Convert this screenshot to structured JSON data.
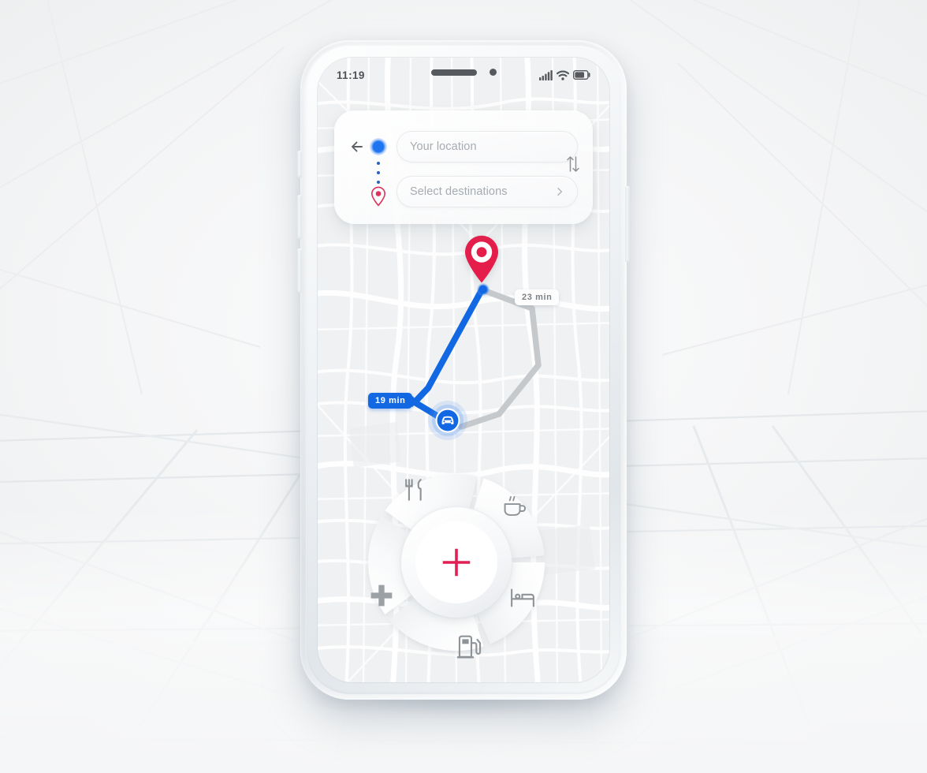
{
  "status_bar": {
    "time": "11:19",
    "signal_icon": "cellular-signal-icon",
    "wifi_icon": "wifi-icon",
    "battery_icon": "battery-icon"
  },
  "search_panel": {
    "back_icon": "back-arrow-icon",
    "origin_icon": "origin-dot-icon",
    "destination_icon": "destination-pin-icon",
    "swap_icon": "swap-vertical-icon",
    "origin_placeholder": "Your location",
    "origin_value": "",
    "destination_placeholder": "Select destinations",
    "destination_value": "",
    "destination_chevron_icon": "chevron-right-icon"
  },
  "map": {
    "destination_pin_icon": "map-pin-icon",
    "vehicle_marker_icon": "car-icon",
    "routes": [
      {
        "id": "primary",
        "label": "19 min",
        "color": "#1268e3",
        "selected": true
      },
      {
        "id": "alternate",
        "label": "23 min",
        "color": "#c6c9cc",
        "selected": false
      }
    ]
  },
  "radial_menu": {
    "center_label": "+",
    "center_icon": "plus-icon",
    "center_color": "#e01f52",
    "segments": [
      {
        "id": "restaurants",
        "icon": "fork-knife-icon",
        "label": "Restaurants"
      },
      {
        "id": "cafes",
        "icon": "coffee-cup-icon",
        "label": "Cafes"
      },
      {
        "id": "hotels",
        "icon": "bed-icon",
        "label": "Hotels"
      },
      {
        "id": "gas",
        "icon": "fuel-pump-icon",
        "label": "Gas stations"
      },
      {
        "id": "pharmacy",
        "icon": "medical-cross-icon",
        "label": "Pharmacy"
      }
    ]
  },
  "theme": {
    "accent_blue": "#1268e3",
    "accent_red": "#e01f52",
    "map_base": "#f0f1f2",
    "road_color": "#ffffff"
  }
}
